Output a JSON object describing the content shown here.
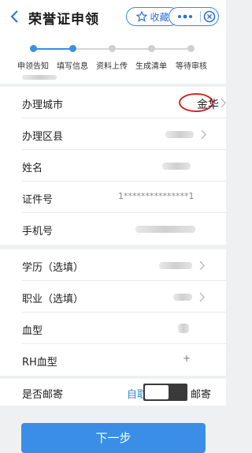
{
  "header": {
    "title": "荣誉证申领",
    "favorite_label": "收藏"
  },
  "steps": [
    {
      "label": "申领告知",
      "state": "done"
    },
    {
      "label": "填写信息",
      "state": "current"
    },
    {
      "label": "资料上传",
      "state": "todo"
    },
    {
      "label": "生成清单",
      "state": "todo"
    },
    {
      "label": "等待审核",
      "state": "todo"
    }
  ],
  "form": {
    "city": {
      "label": "办理城市",
      "value": "金华"
    },
    "district": {
      "label": "办理区县"
    },
    "name": {
      "label": "姓名"
    },
    "id_number": {
      "label": "证件号",
      "value": "1***************1"
    },
    "phone": {
      "label": "手机号"
    },
    "education": {
      "label": "学历（选填）"
    },
    "occupation": {
      "label": "职业（选填）"
    },
    "blood_type": {
      "label": "血型"
    },
    "rh_type": {
      "label": "RH血型",
      "value": "+"
    },
    "mail": {
      "label": "是否邮寄",
      "option_pickup": "自取",
      "option_mail": "邮寄",
      "selected": "自取"
    }
  },
  "next_button": "下一步",
  "colors": {
    "accent": "#3a8ee6",
    "annotation": "#d42a2a",
    "background": "#eff0f2"
  }
}
